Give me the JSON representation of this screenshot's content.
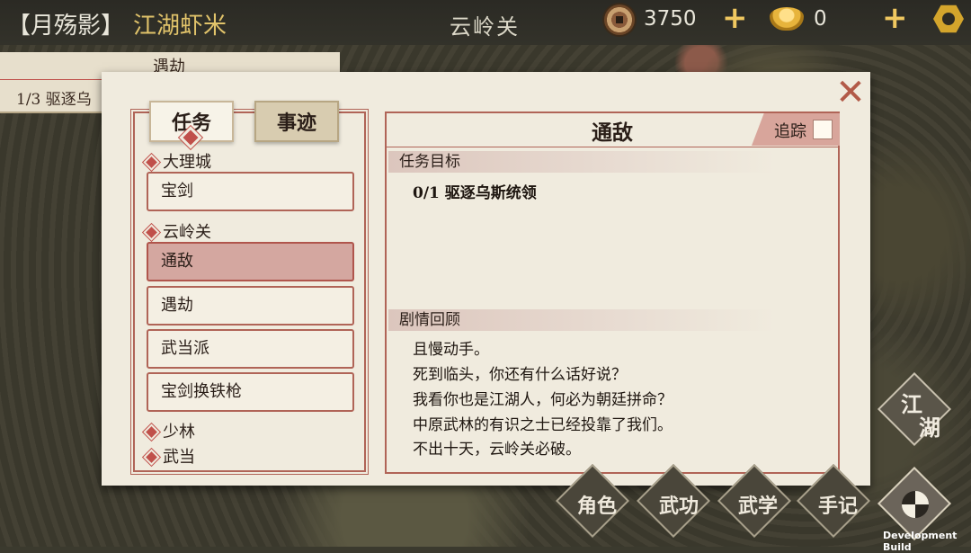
{
  "top_bar": {
    "player_name": "【月殇影】",
    "player_rank": "江湖虾米",
    "location": "云岭关",
    "coins": "3750",
    "ingots": "0"
  },
  "tracker": {
    "title": "遇劫",
    "text": "1/3 驱逐乌"
  },
  "dialog": {
    "tabs": [
      "任务",
      "事迹"
    ],
    "groups": [
      {
        "name": "大理城"
      },
      {
        "name": "云岭关"
      },
      {
        "name": "少林"
      },
      {
        "name": "武当"
      }
    ],
    "tasks": [
      {
        "label": "宝剑",
        "group": "大理城"
      },
      {
        "label": "通敌",
        "group": "云岭关",
        "selected": true
      },
      {
        "label": "遇劫",
        "group": "云岭关"
      },
      {
        "label": "武当派",
        "group": "云岭关"
      },
      {
        "label": "宝剑换铁枪",
        "group": "云岭关"
      }
    ],
    "detail": {
      "title": "通敌",
      "track_label": "追踪",
      "track_checked": false,
      "objective_header": "任务目标",
      "objective": "0/1 驱逐乌斯统领",
      "story_header": "剧情回顾",
      "story_lines": [
        "且慢动手。",
        "死到临头，你还有什么话好说？",
        "我看你也是江湖人，何必为朝廷拼命？",
        "中原武林的有识之士已经投靠了我们。",
        "不出十天，云岭关必破。"
      ]
    }
  },
  "side_menu": {
    "jianghu": [
      "江",
      "湖"
    ]
  },
  "bottom_menu": [
    "角色",
    "武功",
    "武学",
    "手记"
  ],
  "footer": {
    "dev_build": "Development Build"
  },
  "icons": {
    "coin": "coin-icon",
    "ingot": "gold-ingot-icon",
    "settings": "hexagon-gear-icon",
    "close": "close-x-icon",
    "menu": "pinwheel-icon"
  },
  "colors": {
    "accent_red": "#b06457",
    "parchment": "#f0ebde",
    "gold": "#e1c36a"
  }
}
